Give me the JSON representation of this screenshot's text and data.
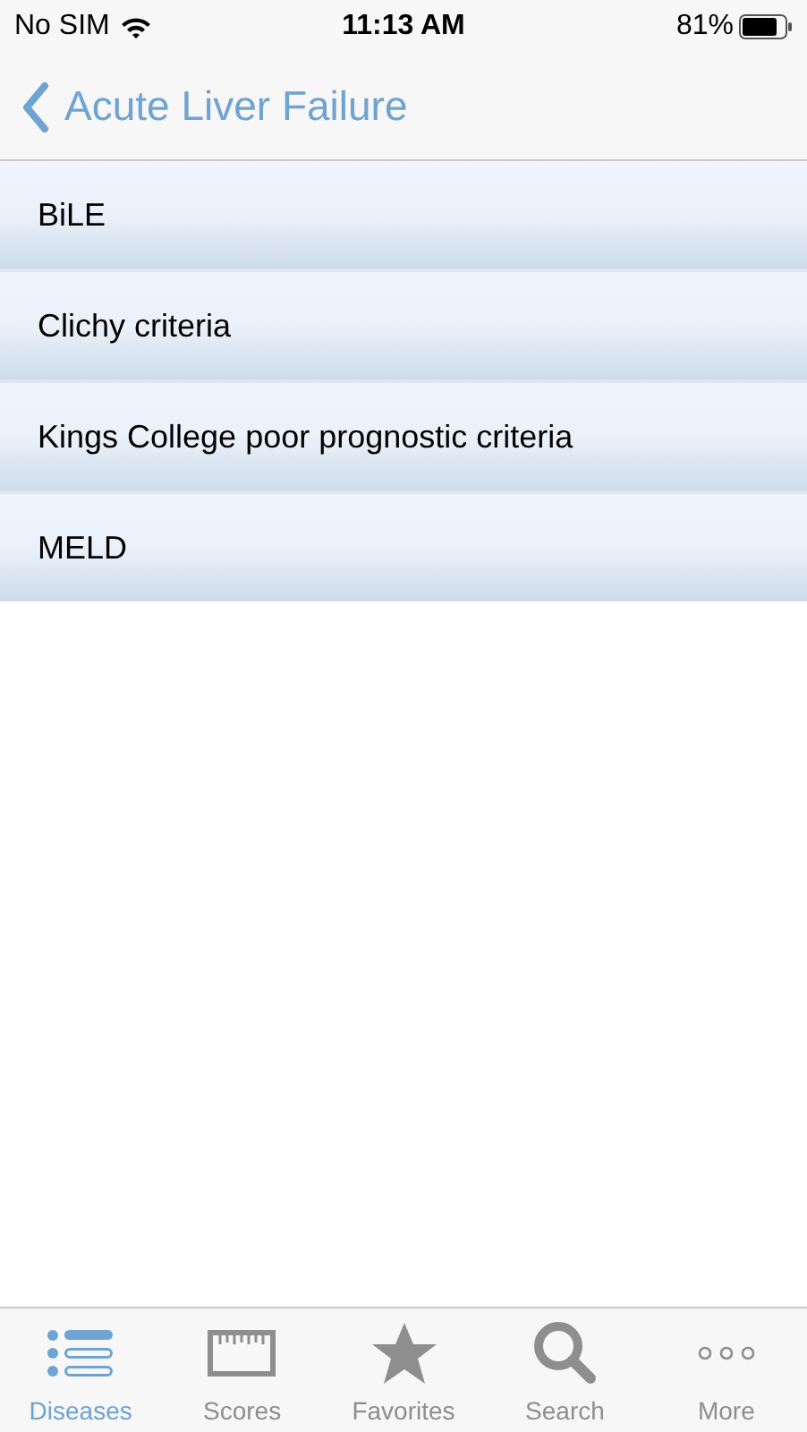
{
  "status_bar": {
    "carrier": "No SIM",
    "time": "11:13 AM",
    "battery": "81%"
  },
  "nav_bar": {
    "back_title": "Acute Liver Failure"
  },
  "list": {
    "items": [
      {
        "label": "BiLE"
      },
      {
        "label": "Clichy criteria"
      },
      {
        "label": "Kings College poor prognostic criteria"
      },
      {
        "label": "MELD"
      }
    ]
  },
  "tab_bar": {
    "tabs": [
      {
        "label": "Diseases",
        "kind": "list",
        "selected": true
      },
      {
        "label": "Scores",
        "kind": "ruler",
        "selected": false
      },
      {
        "label": "Favorites",
        "kind": "star",
        "selected": false
      },
      {
        "label": "Search",
        "kind": "search",
        "selected": false
      },
      {
        "label": "More",
        "kind": "more",
        "selected": false
      }
    ]
  }
}
